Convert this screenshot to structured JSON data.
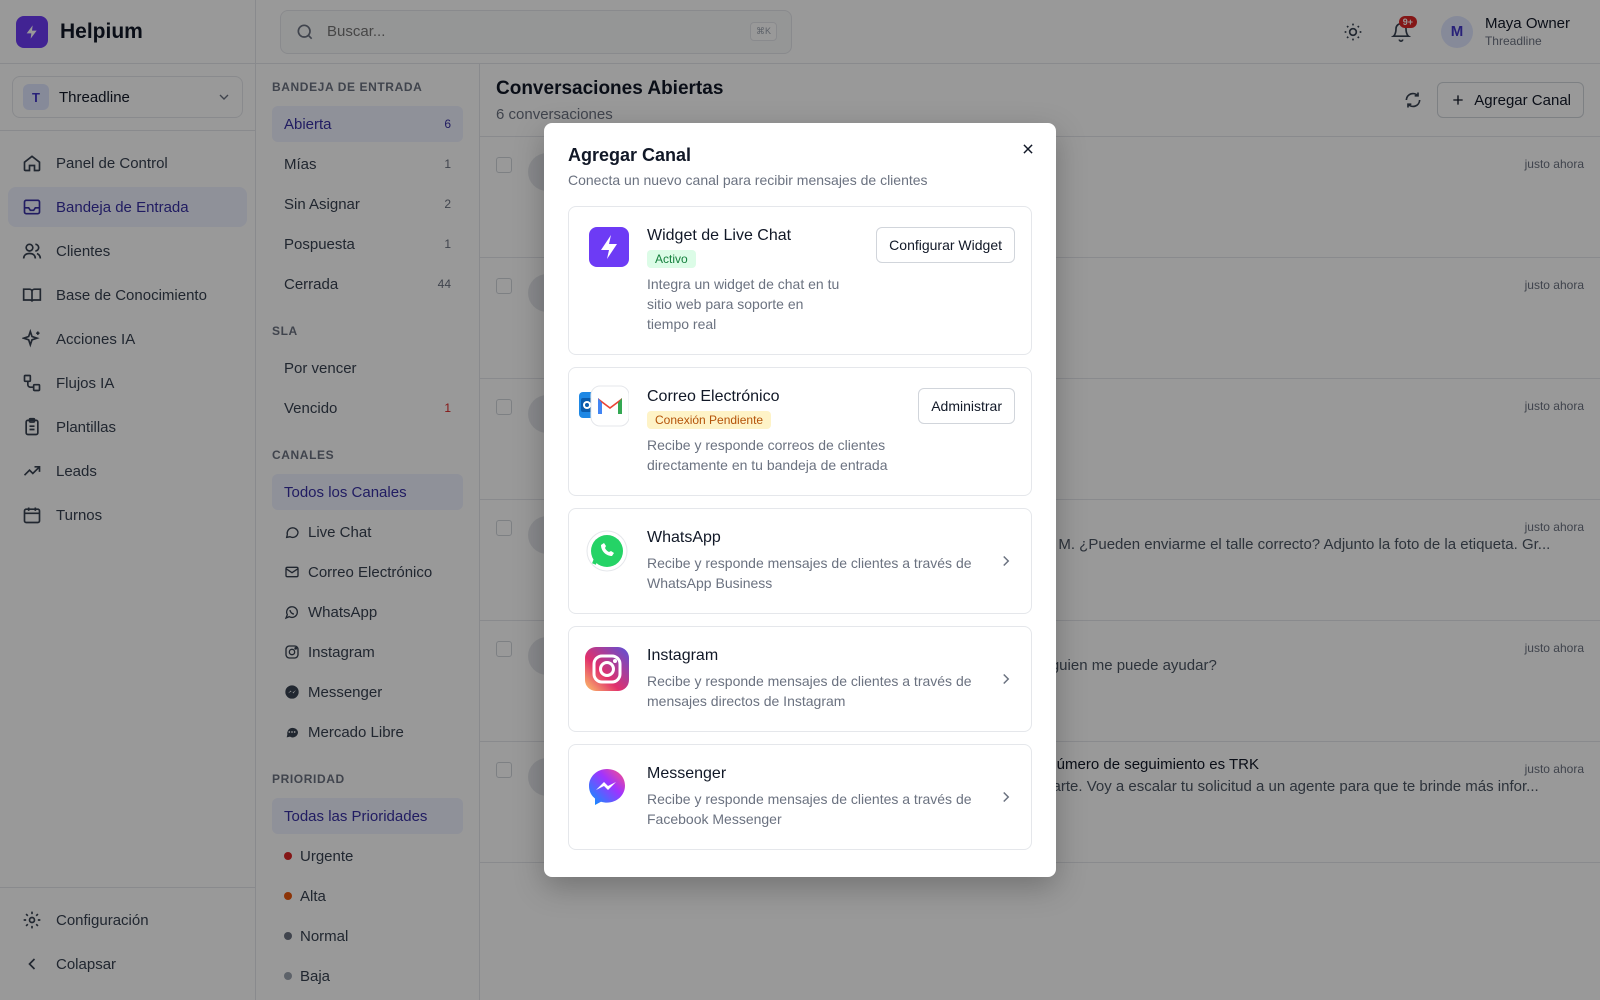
{
  "app": {
    "name": "Helpium"
  },
  "workspace": {
    "initial": "T",
    "name": "Threadline"
  },
  "nav": [
    {
      "label": "Panel de Control",
      "icon": "home-icon"
    },
    {
      "label": "Bandeja de Entrada",
      "icon": "inbox-icon",
      "active": true
    },
    {
      "label": "Clientes",
      "icon": "users-icon"
    },
    {
      "label": "Base de Conocimiento",
      "icon": "book-icon"
    },
    {
      "label": "Acciones IA",
      "icon": "sparkles-icon"
    },
    {
      "label": "Flujos IA",
      "icon": "workflow-icon"
    },
    {
      "label": "Plantillas",
      "icon": "clipboard-icon"
    },
    {
      "label": "Leads",
      "icon": "trending-up-icon"
    },
    {
      "label": "Turnos",
      "icon": "calendar-icon"
    }
  ],
  "sidebar_bottom": {
    "settings": "Configuración",
    "collapse": "Colapsar"
  },
  "header": {
    "search_placeholder": "Buscar...",
    "shortcut": "⌘K",
    "notif_badge": "9+",
    "user_initial": "M",
    "user_name": "Maya Owner",
    "user_org": "Threadline"
  },
  "inbox": {
    "section": "BANDEJA DE ENTRADA",
    "items": [
      {
        "label": "Abierta",
        "count": "6",
        "active": true
      },
      {
        "label": "Mías",
        "count": "1"
      },
      {
        "label": "Sin Asignar",
        "count": "2"
      },
      {
        "label": "Pospuesta",
        "count": "1"
      },
      {
        "label": "Cerrada",
        "count": "44"
      }
    ]
  },
  "sla": {
    "section": "SLA",
    "items": [
      {
        "label": "Por vencer",
        "count": ""
      },
      {
        "label": "Vencido",
        "count": "1",
        "alert": true
      }
    ]
  },
  "channels": {
    "section": "CANALES",
    "all": "Todos los Canales",
    "items": [
      {
        "label": "Live Chat",
        "icon": "chat-bubble-icon"
      },
      {
        "label": "Correo Electrónico",
        "icon": "mail-icon"
      },
      {
        "label": "WhatsApp",
        "icon": "whatsapp-icon"
      },
      {
        "label": "Instagram",
        "icon": "instagram-icon"
      },
      {
        "label": "Messenger",
        "icon": "messenger-icon"
      },
      {
        "label": "Mercado Libre",
        "icon": "mercadolibre-icon"
      }
    ]
  },
  "priority": {
    "section": "PRIORIDAD",
    "all": "Todas las Prioridades",
    "items": [
      {
        "label": "Urgente",
        "color": "#dc2626"
      },
      {
        "label": "Alta",
        "color": "#ea580c"
      },
      {
        "label": "Normal",
        "color": "#6b7280"
      },
      {
        "label": "Baja",
        "color": "#9ca3af"
      }
    ]
  },
  "main": {
    "title": "Conversaciones Abiertas",
    "subtitle": "6 conversaciones",
    "add_channel": "Agregar Canal",
    "rows": [
      {
        "time": "justo ahora",
        "preview": "",
        "preview2": ""
      },
      {
        "time": "justo ahora",
        "preview": "",
        "preview2": ""
      },
      {
        "time": "justo ahora",
        "preview": "",
        "preview2": ""
      },
      {
        "time": "justo ahora",
        "preview": "ar de M. ¿Pueden enviarme el talle correcto? Adjunto la foto de la etiqueta. Gr...",
        "preview2": ""
      },
      {
        "time": "justo ahora",
        "preview": ". ¿Alguien me puede ayudar?",
        "preview2": ""
      },
      {
        "time": "justo ahora",
        "preview": ". Mi número de seguimiento es TRK",
        "preview2": "ayudarte. Voy a escalar tu solicitud a un agente para que te brinde más infor..."
      }
    ]
  },
  "modal": {
    "title": "Agregar Canal",
    "subtitle": "Conecta un nuevo canal para recibir mensajes de clientes",
    "channels": [
      {
        "name": "Widget de Live Chat",
        "badge": "Activo",
        "desc": "Integra un widget de chat en tu sitio web para soporte en tiempo real",
        "action": "Configurar Widget"
      },
      {
        "name": "Correo Electrónico",
        "badge": "Conexión Pendiente",
        "desc": "Recibe y responde correos de clientes directamente en tu bandeja de entrada",
        "action": "Administrar"
      },
      {
        "name": "WhatsApp",
        "desc": "Recibe y responde mensajes de clientes a través de WhatsApp Business"
      },
      {
        "name": "Instagram",
        "desc": "Recibe y responde mensajes de clientes a través de mensajes directos de Instagram"
      },
      {
        "name": "Messenger",
        "desc": "Recibe y responde mensajes de clientes a través de Facebook Messenger"
      }
    ]
  },
  "colors": {
    "brand": "#6d3bf5",
    "active_bg": "#eef2ff",
    "active_text": "#3730a3",
    "whatsapp": "#25d366",
    "overlay": "rgba(0,0,0,0.4)"
  }
}
